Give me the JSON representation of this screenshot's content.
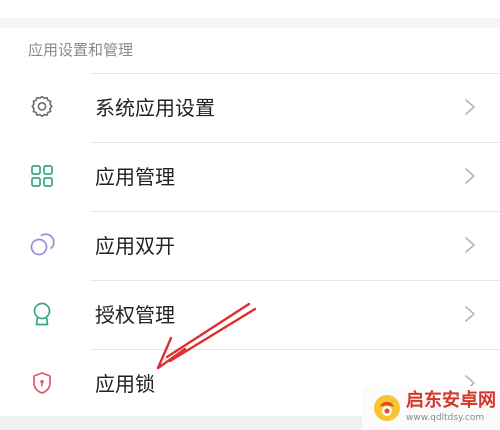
{
  "section": {
    "title": "应用设置和管理"
  },
  "items": [
    {
      "label": "系统应用设置",
      "icon": "gear-icon"
    },
    {
      "label": "应用管理",
      "icon": "grid-apps-icon"
    },
    {
      "label": "应用双开",
      "icon": "dual-circles-icon"
    },
    {
      "label": "授权管理",
      "icon": "badge-icon"
    },
    {
      "label": "应用锁",
      "icon": "shield-lock-icon"
    }
  ],
  "colors": {
    "gear": "#6b6b6b",
    "grid": "#3aa77a",
    "dual": "#9b8cd6",
    "badge": "#3aa77a",
    "shield": "#e0566d",
    "arrow": "#e02d2d",
    "chevron": "#b5b5b5"
  },
  "watermark": {
    "title": "启东安卓网",
    "url": "www.qdltdsy.com"
  }
}
